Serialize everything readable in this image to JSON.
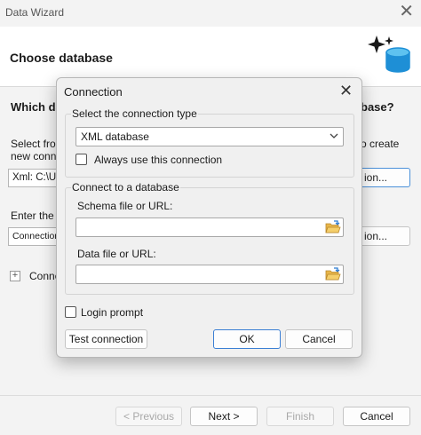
{
  "wizard": {
    "title": "Data Wizard",
    "close_glyph": "✕",
    "heading": "Choose database",
    "question_left": "Which da",
    "question_right": "base?",
    "select_text_1": "Select fron",
    "select_text_2": "new conn",
    "select_text_right": "o create",
    "connection_value": "Xml: C:\\U",
    "connection_button_tail": "ion...",
    "enter_text": "Enter the",
    "connection_field2": "Connection",
    "connection_button2_tail": "ion...",
    "expand_glyph": "+",
    "expand_label": "Conne",
    "buttons": {
      "previous": "< Previous",
      "next": "Next >",
      "finish": "Finish",
      "cancel": "Cancel"
    },
    "icons": {
      "logo": "sparkle-database-icon"
    },
    "colors": {
      "accent": "#1e8fd6"
    }
  },
  "dialog": {
    "title": "Connection",
    "close_glyph": "✕",
    "type_group_label": "Select the connection type",
    "type_selected": "XML database",
    "always_use_label": "Always use this connection",
    "always_use_checked": false,
    "connect_group_label": "Connect to a database",
    "schema_label": "Schema file or URL:",
    "schema_value": "",
    "data_label": "Data file or URL:",
    "data_value": "",
    "login_prompt_label": "Login prompt",
    "login_prompt_checked": false,
    "test_button": "Test connection",
    "ok_button": "OK",
    "cancel_button": "Cancel",
    "icons": {
      "dropdown": "chevron-down-icon",
      "browse": "folder-open-icon"
    }
  }
}
